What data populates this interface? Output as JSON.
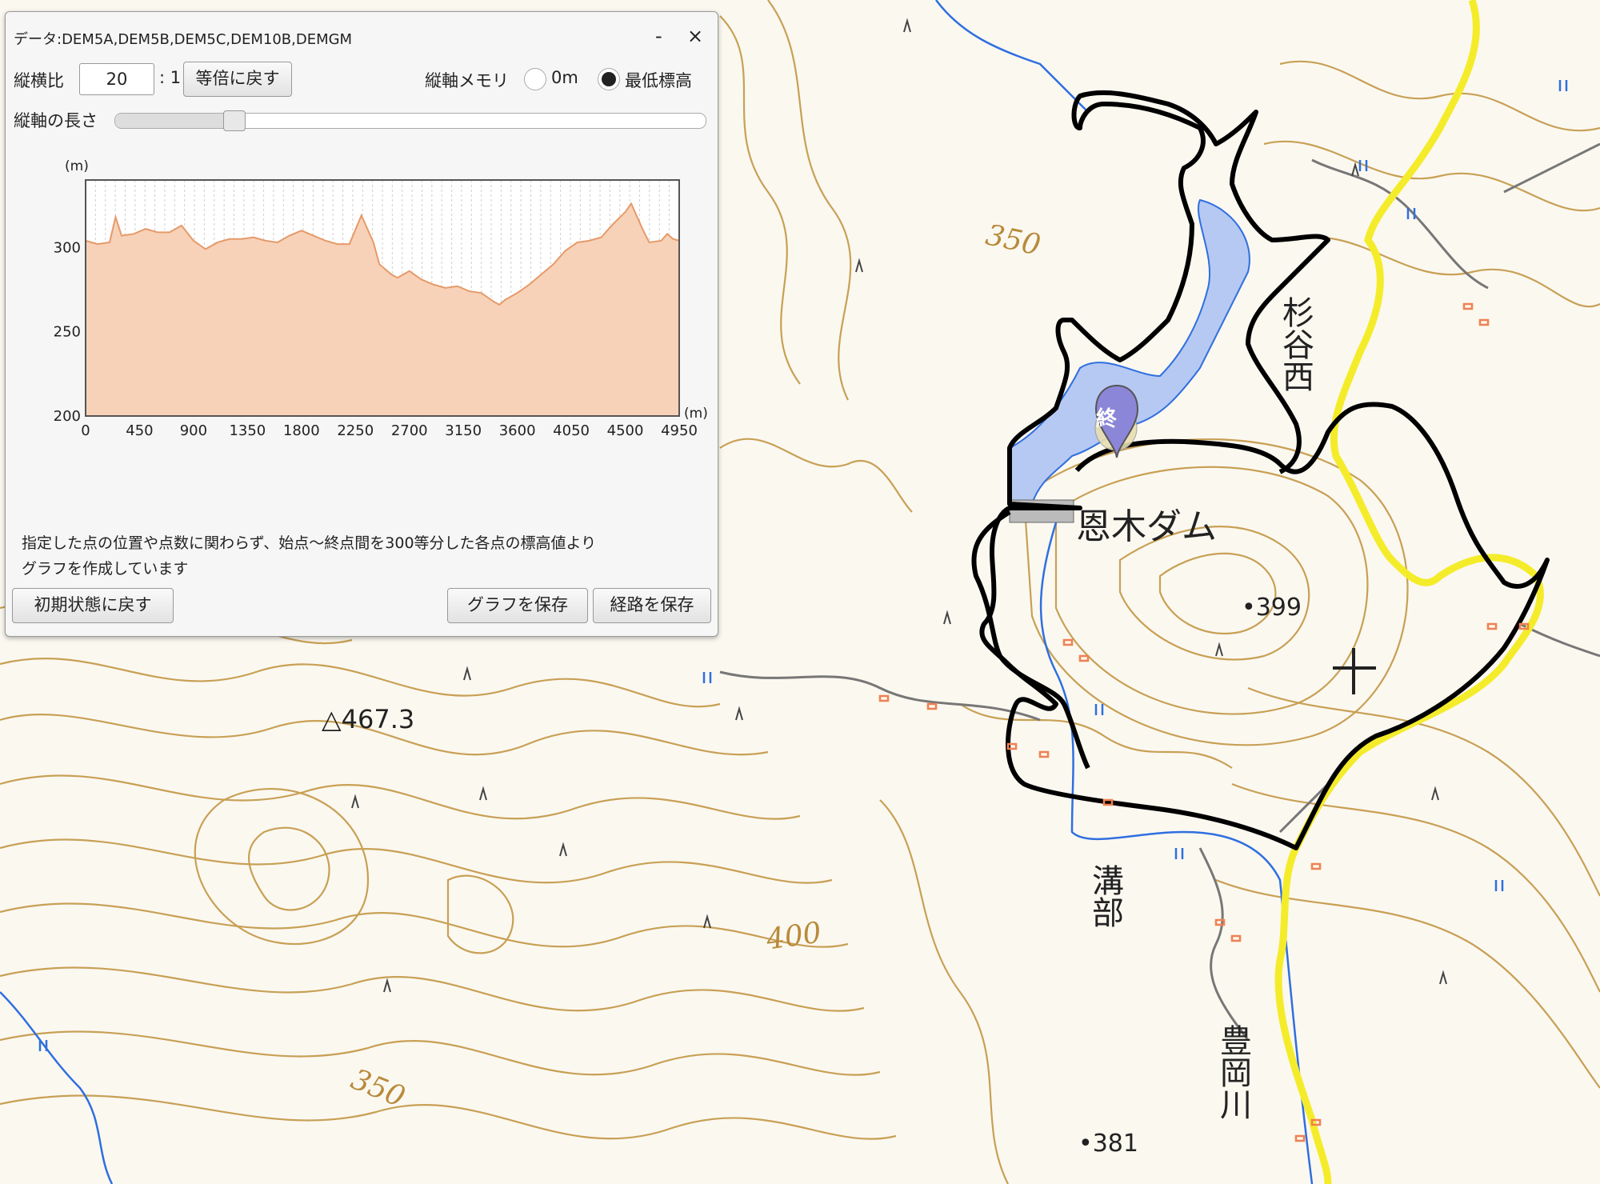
{
  "map": {
    "labels": {
      "dam": "恩木ダム",
      "place_suginishi": "杉谷西",
      "place_mizobe": "溝部",
      "river": "豊岡川",
      "summit": "△467.3",
      "peak_399": "•399",
      "peak_381": "•381"
    },
    "contour_labels": [
      "350",
      "400",
      "350"
    ],
    "marker_label": "終",
    "colors": {
      "contour": "#c8a055",
      "water": "#b6c9f2",
      "stream": "#2f6fe0",
      "route": "#000000",
      "highway": "#f4ec2a",
      "road": "#777777"
    }
  },
  "panel": {
    "title": "データ:DEM5A,DEM5B,DEM5C,DEM10B,DEMGM",
    "minimize_label": "-",
    "close_label": "×",
    "aspect_label": "縦横比",
    "aspect_value": "20",
    "aspect_suffix": ": 1",
    "reset_ratio_label": "等倍に戻す",
    "axis_memory_label": "縦軸メモリ",
    "radio_zero_label": "0m",
    "radio_min_label": "最低標高",
    "selected_radio": "最低標高",
    "axis_length_label": "縦軸の長さ",
    "axis_length_level": 0.2,
    "note_line1": "指定した点の位置や点数に関わらず、始点～終点間を300等分した各点の標高値より",
    "note_line2": "グラフを作成しています",
    "reset_button": "初期状態に戻す",
    "save_graph_button": "グラフを保存",
    "save_route_button": "経路を保存"
  },
  "chart_data": {
    "type": "area",
    "ylabel": "(m)",
    "xlabel": "(m)",
    "xlim": [
      0,
      4950
    ],
    "ylim": [
      200,
      340
    ],
    "x_ticks": [
      0,
      450,
      900,
      1350,
      1800,
      2250,
      2700,
      3150,
      3600,
      4050,
      4500,
      4950
    ],
    "y_ticks": [
      200,
      250,
      300
    ],
    "grid": "vertical",
    "series": [
      {
        "x": [
          0,
          100,
          200,
          250,
          300,
          400,
          500,
          600,
          700,
          800,
          900,
          1000,
          1100,
          1200,
          1300,
          1400,
          1500,
          1600,
          1700,
          1800,
          1900,
          2000,
          2100,
          2200,
          2300,
          2400,
          2450,
          2550,
          2600,
          2700,
          2800,
          2900,
          3000,
          3100,
          3200,
          3300,
          3400,
          3450,
          3500,
          3600,
          3700,
          3800,
          3900,
          4000,
          4100,
          4200,
          4300,
          4400,
          4500,
          4550,
          4600,
          4650,
          4700,
          4800,
          4850,
          4900,
          4950
        ],
        "values": [
          304,
          302,
          303,
          318,
          307,
          308,
          311,
          309,
          309,
          313,
          304,
          299,
          303,
          305,
          305,
          306,
          304,
          303,
          307,
          310,
          307,
          304,
          302,
          302,
          319,
          303,
          290,
          284,
          282,
          286,
          281,
          278,
          276,
          277,
          274,
          273,
          268,
          266,
          269,
          273,
          278,
          284,
          290,
          298,
          303,
          304,
          306,
          314,
          321,
          326,
          318,
          310,
          303,
          304,
          308,
          305,
          304
        ]
      }
    ]
  }
}
